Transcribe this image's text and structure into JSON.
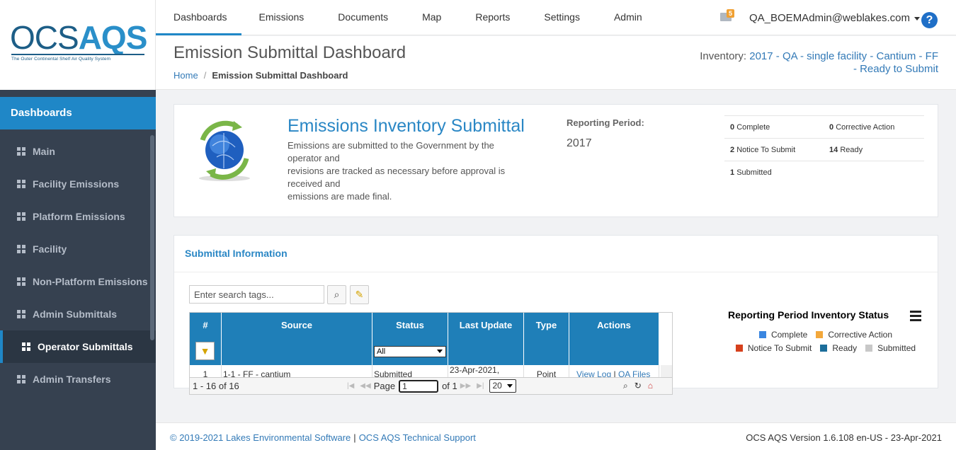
{
  "brand": {
    "logo_left": "OCS",
    "logo_right": "AQS",
    "tagline": "The Outer Continental Shelf Air Quality System"
  },
  "sidebar": {
    "title": "Dashboards",
    "items": [
      {
        "label": "Main"
      },
      {
        "label": "Facility Emissions"
      },
      {
        "label": "Platform Emissions"
      },
      {
        "label": "Facility"
      },
      {
        "label": "Non-Platform Emissions"
      },
      {
        "label": "Admin Submittals"
      },
      {
        "label": "Operator Submittals"
      },
      {
        "label": "Admin Transfers"
      }
    ]
  },
  "topnav": {
    "tabs": [
      {
        "label": "Dashboards"
      },
      {
        "label": "Emissions"
      },
      {
        "label": "Documents"
      },
      {
        "label": "Map"
      },
      {
        "label": "Reports"
      },
      {
        "label": "Settings"
      },
      {
        "label": "Admin"
      }
    ],
    "mail_count": "5",
    "user": "QA_BOEMAdmin@weblakes.com",
    "help": "?"
  },
  "page": {
    "title": "Emission Submittal Dashboard",
    "breadcrumb_home": "Home",
    "breadcrumb_sep": "/",
    "breadcrumb_current": "Emission Submittal Dashboard",
    "inventory_label": "Inventory:",
    "inventory_value_1": "2017 - QA - single facility - Cantium - FF",
    "inventory_value_2": "- Ready to Submit"
  },
  "summary": {
    "title": "Emissions Inventory Submittal",
    "desc_1": "Emissions are submitted to the Government by the operator and",
    "desc_2": "revisions are tracked as necessary before approval is received and",
    "desc_3": "emissions are made final.",
    "reporting_label": "Reporting Period:",
    "reporting_value": "2017",
    "stats": {
      "complete_n": "0",
      "complete_l": "Complete",
      "corrective_n": "0",
      "corrective_l": "Corrective Action",
      "notice_n": "2",
      "notice_l": "Notice To Submit",
      "ready_n": "14",
      "ready_l": "Ready",
      "submitted_n": "1",
      "submitted_l": "Submitted"
    }
  },
  "submittal": {
    "title": "Submittal Information",
    "search_placeholder": "Enter search tags...",
    "columns": [
      "#",
      "Source",
      "Status",
      "Last Update",
      "Type",
      "Actions"
    ],
    "status_filter": "All",
    "row": {
      "num": "1",
      "source": "1-1 - FF - cantium",
      "status": "Submitted",
      "last_update": "23-Apr-2021,",
      "type": "Point",
      "action_1": "View Log",
      "action_sep": "|",
      "action_2": "QA Files"
    },
    "records": "1 - 16 of 16",
    "page_label": "Page",
    "page_value": "1",
    "page_of": "of 1",
    "rows_per_page": "20"
  },
  "status_chart": {
    "title": "Reporting Period Inventory Status",
    "legend": [
      {
        "name": "Complete",
        "color": "#3a86e0"
      },
      {
        "name": "Corrective Action",
        "color": "#f3a83b"
      },
      {
        "name": "Notice To Submit",
        "color": "#d6401c"
      },
      {
        "name": "Ready",
        "color": "#1b6d9a"
      },
      {
        "name": "Submitted",
        "color": "#c8c8c8"
      }
    ]
  },
  "footer": {
    "copyright": "© 2019-2021 Lakes Environmental Software",
    "sep": "|",
    "support": "OCS AQS Technical Support",
    "version": "OCS AQS Version 1.6.108 en-US - 23-Apr-2021"
  },
  "colors": {
    "accent": "#1f87c7",
    "sidebar_bg": "#364150",
    "grid_header": "#1f7fb8"
  }
}
